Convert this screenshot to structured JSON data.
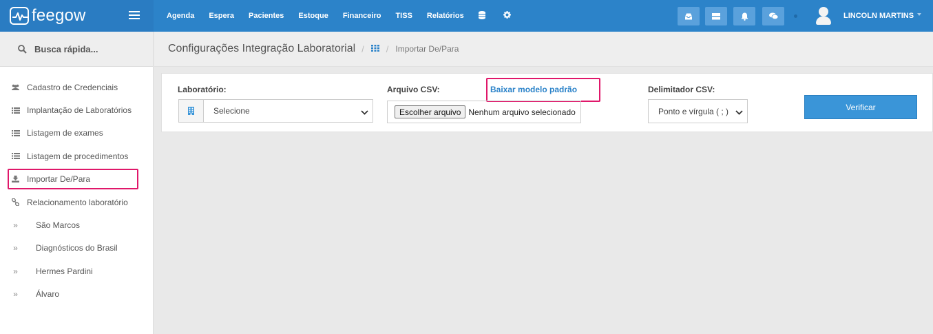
{
  "brand": {
    "logo_text": "feegow",
    "logo_icon": "heartbeat-icon",
    "menu_icon": "hamburger-icon"
  },
  "topnav": {
    "items": [
      "Agenda",
      "Espera",
      "Pacientes",
      "Estoque",
      "Financeiro",
      "TISS",
      "Relatórios"
    ],
    "extra_icons": [
      "database-icon",
      "gear-icon"
    ]
  },
  "toolbar": {
    "buttons": [
      "inbox-icon",
      "server-icon",
      "bell-icon",
      "chat-icon"
    ],
    "user_name": "LINCOLN MARTINS",
    "user_icon": "user-avatar-icon"
  },
  "sidebar": {
    "quick_search": "Busca rápida...",
    "items": [
      {
        "label": "Cadastro de Credenciais",
        "icon": "users-icon"
      },
      {
        "label": "Implantação de Laboratórios",
        "icon": "list-icon"
      },
      {
        "label": "Listagem de exames",
        "icon": "list-icon"
      },
      {
        "label": "Listagem de procedimentos",
        "icon": "list-icon"
      },
      {
        "label": "Importar De/Para",
        "icon": "download-icon"
      },
      {
        "label": "Relacionamento laboratório",
        "icon": "link-icon"
      },
      {
        "label": "São Marcos",
        "icon": "double-chevron-right-icon"
      },
      {
        "label": "Diagnósticos do Brasil",
        "icon": "double-chevron-right-icon"
      },
      {
        "label": "Hermes Pardini",
        "icon": "double-chevron-right-icon"
      },
      {
        "label": "Álvaro",
        "icon": "double-chevron-right-icon"
      }
    ]
  },
  "breadcrumb": {
    "title": "Configurações Integração Laboratorial",
    "sep": "/",
    "current": "Importar De/Para"
  },
  "form": {
    "lab_label": "Laboratório:",
    "lab_value": "Selecione",
    "csv_label": "Arquivo CSV:",
    "file_button": "Escolher arquivo",
    "file_status": "Nenhum arquivo selecionado",
    "download_link": "Baixar modelo padrão",
    "delim_label": "Delimitador CSV:",
    "delim_value": "Ponto e vírgula ( ; )",
    "verify_button": "Verificar"
  },
  "colors": {
    "topbar": "#2c83c9",
    "highlight": "#e0176a",
    "primary_button": "#3a95d8"
  }
}
